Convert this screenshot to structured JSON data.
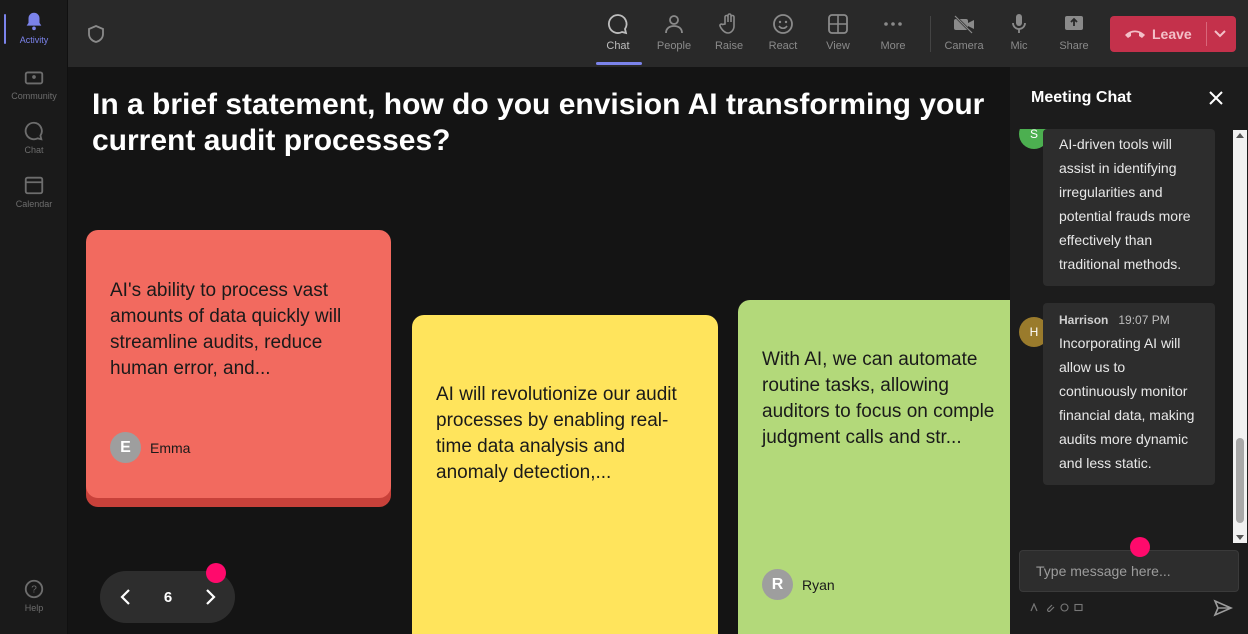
{
  "rail": {
    "items": [
      {
        "label": "Activity",
        "icon": "bell-icon"
      },
      {
        "label": "Community",
        "icon": "community-icon"
      },
      {
        "label": "Chat",
        "icon": "chat-icon"
      },
      {
        "label": "Calendar",
        "icon": "calendar-icon"
      },
      {
        "label": "Help",
        "icon": "help-icon"
      }
    ]
  },
  "toolbar": {
    "chat": "Chat",
    "people": "People",
    "raise": "Raise",
    "react": "React",
    "view": "View",
    "more": "More",
    "camera": "Camera",
    "mic": "Mic",
    "share": "Share",
    "leave": "Leave"
  },
  "stage": {
    "question": "In a brief statement, how do you envision AI transforming your current audit processes?",
    "cards": [
      {
        "text": "AI's ability to process vast amounts of data quickly will streamline audits, reduce human error, and...",
        "author": "Emma",
        "initial": "E",
        "color": "#f26a5f"
      },
      {
        "text": "AI will revolutionize our audit processes by enabling real-time data analysis and anomaly detection,...",
        "author": "",
        "initial": "",
        "color": "#ffe45c"
      },
      {
        "text": "With AI, we can automate routine tasks, allowing auditors to focus on complex judgment calls and str...",
        "line1": "With AI, we can automate",
        "line2": "routine tasks, allowing",
        "line3": "auditors to focus on comple",
        "line4": "judgment calls and str...",
        "author": "Ryan",
        "initial": "R",
        "color": "#b3d97a"
      }
    ],
    "page": "6"
  },
  "chat": {
    "title": "Meeting Chat",
    "messages": [
      {
        "initial": "S",
        "avatar_color": "#4caf50",
        "name": "",
        "time": "",
        "text": "AI-driven tools will assist in identifying irregularities and potential frauds more effectively than traditional methods."
      },
      {
        "initial": "H",
        "avatar_color": "#9a7b2c",
        "name": "Harrison",
        "time": "19:07 PM",
        "text": "Incorporating AI will allow us to continuously monitor financial data, making audits more dynamic and less static."
      }
    ],
    "placeholder": "Type message here..."
  },
  "colors": {
    "accent": "#7b83eb",
    "leave": "#c4314b",
    "marker": "#ff0a6c"
  }
}
